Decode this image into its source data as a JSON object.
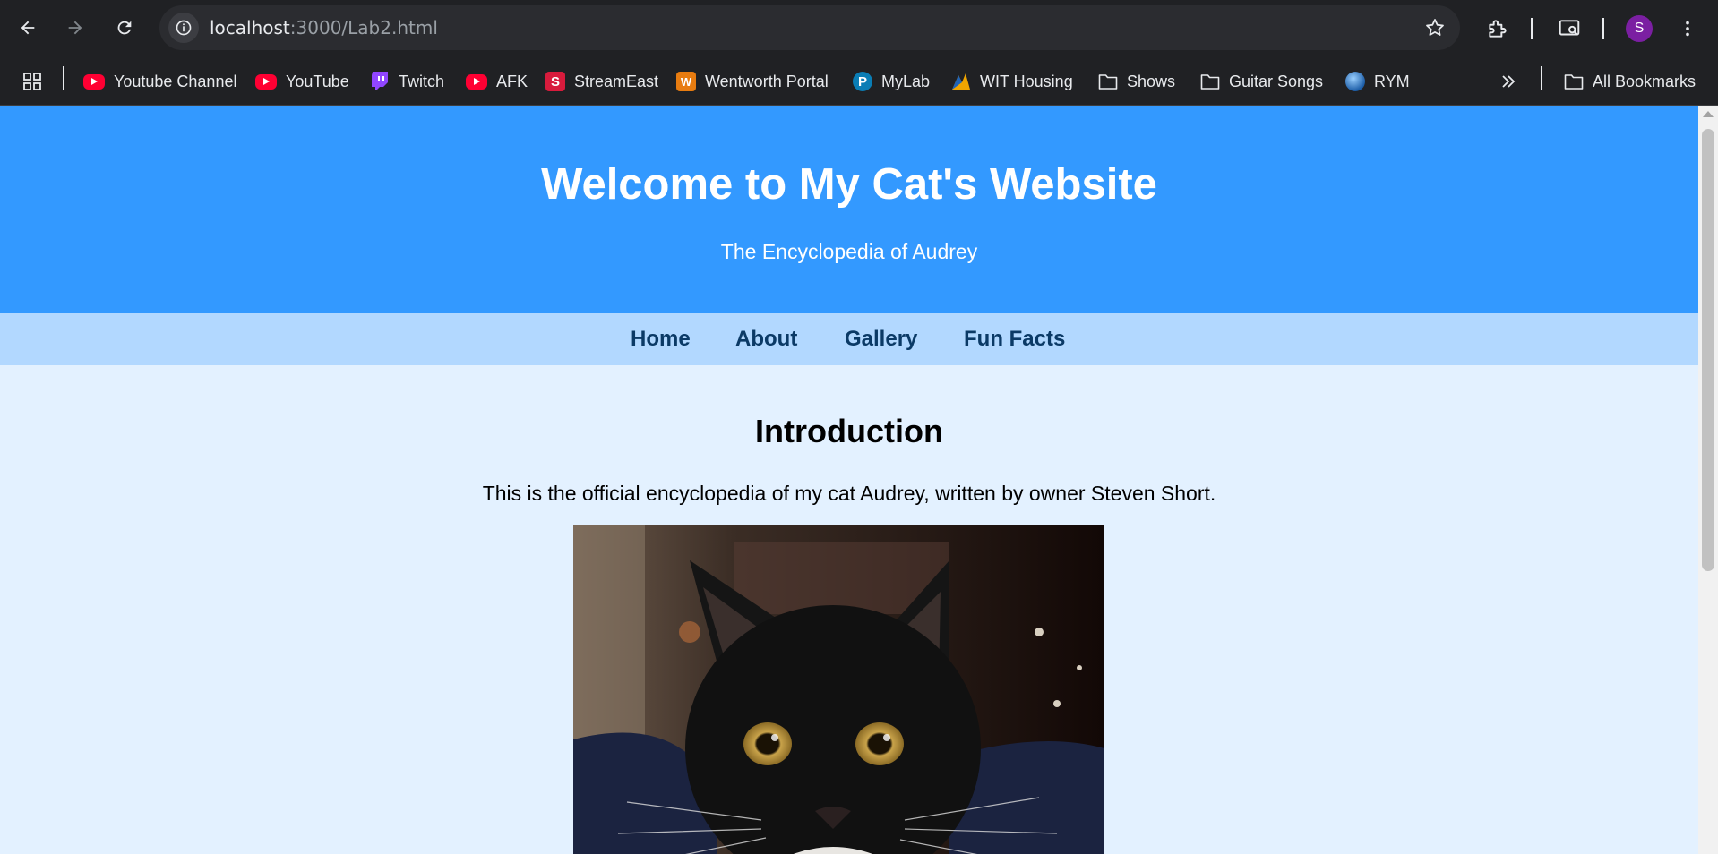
{
  "browser": {
    "url_host": "localhost",
    "url_path": ":3000/Lab2.html",
    "profile_initial": "S",
    "icons": {
      "back": "back-arrow-icon",
      "forward": "forward-arrow-icon",
      "reload": "reload-icon",
      "site_info": "info-icon",
      "bookmark_star": "star-icon",
      "extensions": "puzzle-icon",
      "cast": "cast-icon",
      "menu": "kebab-menu-icon",
      "apps": "apps-grid-icon",
      "overflow": "double-chevron-icon"
    }
  },
  "bookmarks": [
    {
      "label": "Youtube Channel",
      "icon": "youtube-icon"
    },
    {
      "label": "YouTube",
      "icon": "youtube-icon"
    },
    {
      "label": "Twitch",
      "icon": "twitch-icon"
    },
    {
      "label": "AFK",
      "icon": "youtube-icon"
    },
    {
      "label": "StreamEast",
      "icon": "streameast-icon"
    },
    {
      "label": "Wentworth Portal",
      "icon": "wentworth-icon"
    },
    {
      "label": "MyLab",
      "icon": "pearson-icon"
    },
    {
      "label": "WIT Housing",
      "icon": "wit-icon"
    },
    {
      "label": "Shows",
      "icon": "folder-icon"
    },
    {
      "label": "Guitar Songs",
      "icon": "folder-icon"
    },
    {
      "label": "RYM",
      "icon": "rym-icon"
    }
  ],
  "all_bookmarks_label": "All Bookmarks",
  "page": {
    "title": "Welcome to My Cat's Website",
    "subtitle": "The Encyclopedia of Audrey",
    "nav": [
      "Home",
      "About",
      "Gallery",
      "Fun Facts"
    ],
    "intro_heading": "Introduction",
    "intro_text": "This is the official encyclopedia of my cat Audrey, written by owner Steven Short."
  },
  "colors": {
    "header_bg": "#3399ff",
    "nav_bg": "#b2d8ff",
    "page_bg": "#e3f1ff",
    "nav_text": "#0b3a66",
    "chrome_bg": "#202124"
  }
}
